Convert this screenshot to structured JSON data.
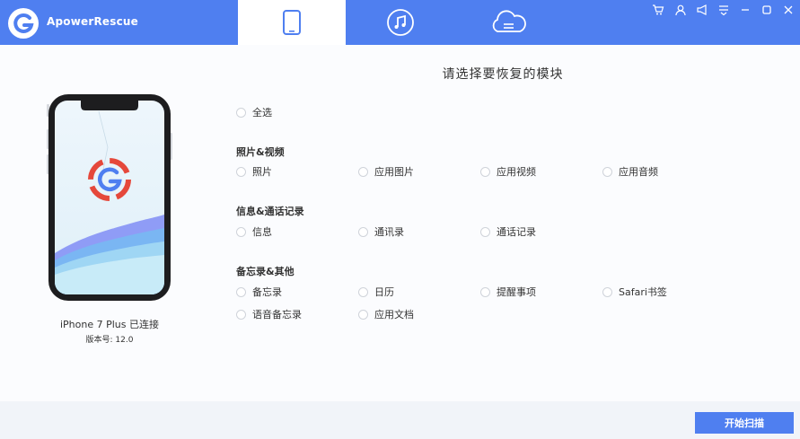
{
  "app": {
    "name": "ApowerRescue"
  },
  "tabs": [
    {
      "id": "device",
      "icon": "phone-icon",
      "active": true
    },
    {
      "id": "music",
      "icon": "music-note-icon",
      "active": false
    },
    {
      "id": "cloud",
      "icon": "cloud-icon",
      "active": false
    }
  ],
  "window_controls": [
    "cart-icon",
    "user-icon",
    "megaphone-icon",
    "menu-icon",
    "minimize-icon",
    "maximize-icon",
    "close-icon"
  ],
  "device": {
    "name": "iPhone 7 Plus 已连接",
    "version": "版本号: 12.0"
  },
  "heading": "请选择要恢复的模块",
  "select_all": "全选",
  "sections": [
    {
      "title": "照片&视频",
      "items": [
        "照片",
        "应用图片",
        "应用视频",
        "应用音频"
      ]
    },
    {
      "title": "信息&通话记录",
      "items": [
        "信息",
        "通讯录",
        "通话记录"
      ]
    },
    {
      "title": "备忘录&其他",
      "items": [
        "备忘录",
        "日历",
        "提醒事项",
        "Safari书签",
        "语音备忘录",
        "应用文档"
      ]
    }
  ],
  "scan_button": "开始扫描",
  "colors": {
    "accent": "#4f7ff0",
    "logo_red": "#e5483b"
  }
}
